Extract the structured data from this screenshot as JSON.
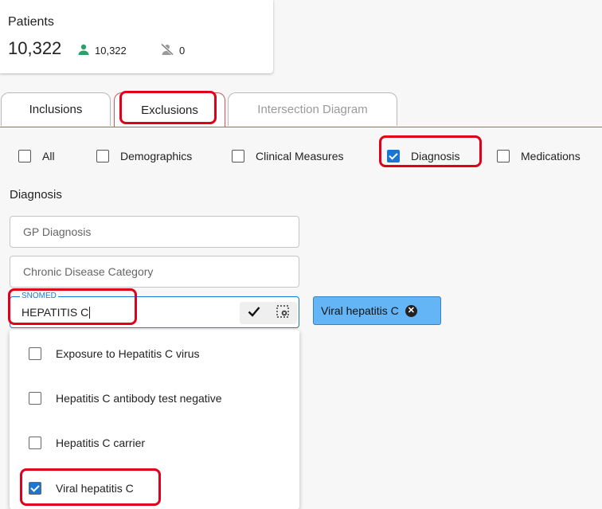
{
  "summary": {
    "title": "Patients",
    "total": "10,322",
    "active_count": "10,322",
    "inactive_count": "0"
  },
  "tabs": [
    {
      "label": "Inclusions",
      "active": false
    },
    {
      "label": "Exclusions",
      "active": true
    },
    {
      "label": "Intersection Diagram",
      "disabled": true
    }
  ],
  "filters": [
    {
      "label": "All",
      "checked": false
    },
    {
      "label": "Demographics",
      "checked": false
    },
    {
      "label": "Clinical Measures",
      "checked": false
    },
    {
      "label": "Diagnosis",
      "checked": true
    },
    {
      "label": "Medications",
      "checked": false
    }
  ],
  "diagnosis": {
    "heading": "Diagnosis",
    "gp_placeholder": "GP Diagnosis",
    "chronic_placeholder": "Chronic Disease Category",
    "snomed_label": "SNOMED",
    "snomed_value": "HEPATITIS C"
  },
  "selected_chip": "Viral hepatitis C",
  "options": [
    {
      "label": "Exposure to Hepatitis C virus",
      "checked": false
    },
    {
      "label": "Hepatitis C antibody test negative",
      "checked": false
    },
    {
      "label": "Hepatitis C carrier",
      "checked": false
    },
    {
      "label": "Viral hepatitis C",
      "checked": true
    }
  ],
  "colors": {
    "accent": "#1976d2",
    "highlight": "#e0001b",
    "chip": "#64b5f6",
    "active_user_icon": "#2e9e6b"
  },
  "icons": {
    "active": "person-icon",
    "inactive": "person-off-icon",
    "confirm": "checkmark-icon",
    "clear": "clear-selection-icon",
    "remove": "close-circle-icon"
  }
}
